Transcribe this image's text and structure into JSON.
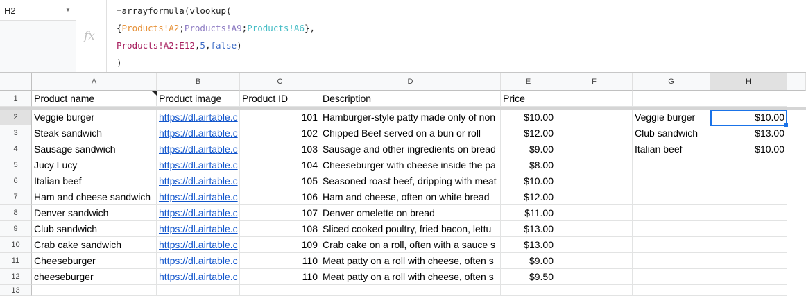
{
  "name_box": {
    "ref": "H2"
  },
  "formula_bar": {
    "fx_icon": "fx",
    "line1": "=arrayformula(vlookup(",
    "line2": {
      "open": "{",
      "ref1": "Products!A2",
      "sep1": ";",
      "ref2": "Products!A9",
      "sep2": ";",
      "ref3": "Products!A6",
      "close": "},"
    },
    "line3": {
      "range": "Products!A2:E12",
      "comma1": ",",
      "index": "5",
      "comma2": ",",
      "flag": "false",
      "close": ")"
    },
    "line4": ")"
  },
  "columns": [
    "A",
    "B",
    "C",
    "D",
    "E",
    "F",
    "G",
    "H"
  ],
  "row_numbers": [
    "1",
    "2",
    "3",
    "4",
    "5",
    "6",
    "7",
    "8",
    "9",
    "10",
    "11",
    "12",
    "13"
  ],
  "header": {
    "a": "Product name",
    "b": "Product image",
    "c": "Product ID",
    "d": "Description",
    "e": "Price"
  },
  "rows": [
    {
      "name": "Veggie burger",
      "image": "https://dl.airtable.c",
      "id": "101",
      "desc": "Hamburger-style patty made only of non",
      "price": "$10.00"
    },
    {
      "name": "Steak sandwich",
      "image": "https://dl.airtable.c",
      "id": "102",
      "desc": "Chipped Beef served on a bun or roll",
      "price": "$12.00"
    },
    {
      "name": "Sausage sandwich",
      "image": "https://dl.airtable.c",
      "id": "103",
      "desc": "Sausage and other ingredients on bread",
      "price": "$9.00"
    },
    {
      "name": "Jucy Lucy",
      "image": "https://dl.airtable.c",
      "id": "104",
      "desc": "Cheeseburger with cheese inside the pa",
      "price": "$8.00"
    },
    {
      "name": "Italian beef",
      "image": "https://dl.airtable.c",
      "id": "105",
      "desc": "Seasoned roast beef, dripping with meat",
      "price": "$10.00"
    },
    {
      "name": "Ham and cheese sandwich",
      "image": "https://dl.airtable.c",
      "id": "106",
      "desc": "Ham and cheese, often on white bread",
      "price": "$12.00"
    },
    {
      "name": "Denver sandwich",
      "image": "https://dl.airtable.c",
      "id": "107",
      "desc": "Denver omelette on bread",
      "price": "$11.00"
    },
    {
      "name": "Club sandwich",
      "image": "https://dl.airtable.c",
      "id": "108",
      "desc": "Sliced cooked poultry, fried bacon, lettu",
      "price": "$13.00"
    },
    {
      "name": "Crab cake sandwich",
      "image": "https://dl.airtable.c",
      "id": "109",
      "desc": "Crab cake on a roll, often with a sauce s",
      "price": "$13.00"
    },
    {
      "name": "Cheeseburger",
      "image": "https://dl.airtable.c",
      "id": "110",
      "desc": "Meat patty on a roll with cheese, often s",
      "price": "$9.00"
    },
    {
      "name": "cheeseburger",
      "image": "https://dl.airtable.c",
      "id": "110",
      "desc": "Meat patty on a roll with cheese, often s",
      "price": "$9.50"
    }
  ],
  "lookup": [
    {
      "g": "Veggie burger",
      "h": "$10.00"
    },
    {
      "g": "Club sandwich",
      "h": "$13.00"
    },
    {
      "g": "Italian beef",
      "h": "$10.00"
    }
  ],
  "colors": {
    "selection": "#1a73e8",
    "link": "#1155cc",
    "ref1": "#e69138",
    "ref2": "#8e7cc3",
    "ref3": "#46bdc6",
    "range": "#a61c5c",
    "literal": "#3d6cc6"
  }
}
